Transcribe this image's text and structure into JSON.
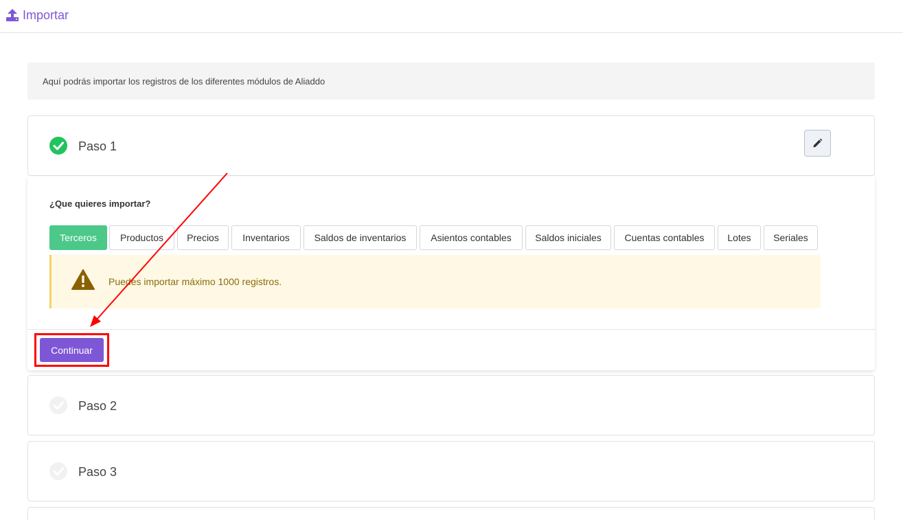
{
  "header": {
    "title": "Importar",
    "icon": "upload-icon"
  },
  "intro_text": "Aquí podrás importar los registros de los diferentes módulos de Aliaddo",
  "steps": [
    {
      "label": "Paso 1",
      "completed": true
    },
    {
      "label": "Paso 2",
      "completed": false
    },
    {
      "label": "Paso 3",
      "completed": false
    }
  ],
  "step1_panel": {
    "question": "¿Que quieres importar?",
    "tabs": [
      {
        "label": "Terceros",
        "active": true
      },
      {
        "label": "Productos",
        "active": false
      },
      {
        "label": "Precios",
        "active": false
      },
      {
        "label": "Inventarios",
        "active": false
      },
      {
        "label": "Saldos de inventarios",
        "active": false
      },
      {
        "label": "Asientos contables",
        "active": false
      },
      {
        "label": "Saldos iniciales",
        "active": false
      },
      {
        "label": "Cuentas contables",
        "active": false
      },
      {
        "label": "Lotes",
        "active": false
      },
      {
        "label": "Seriales",
        "active": false
      }
    ],
    "warning": "Puedes importar máximo 1000 registros.",
    "continue_label": "Continuar"
  },
  "colors": {
    "accent": "#7e57d6",
    "success": "#22c35e",
    "tab_active": "#4cc889",
    "warning_bg": "#fff8e5",
    "warning_text": "#8a6d0b",
    "annotation": "#ff0000"
  }
}
